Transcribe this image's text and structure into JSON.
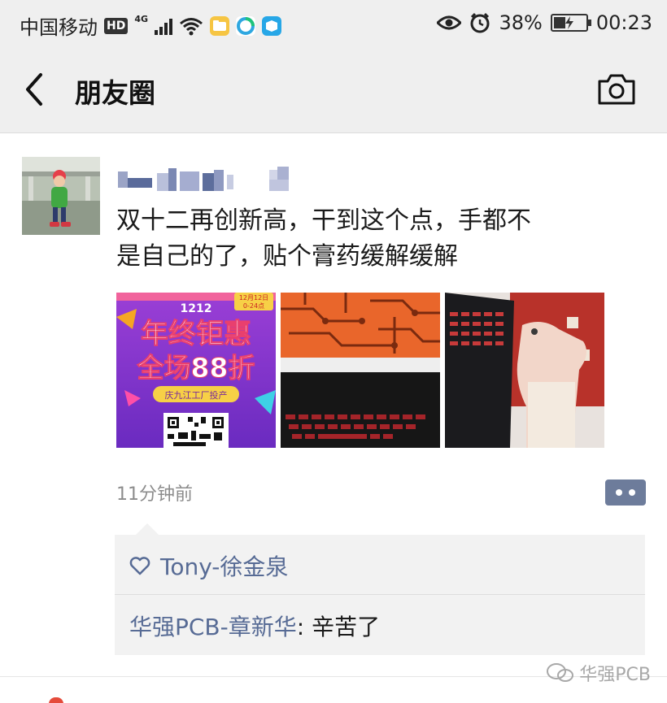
{
  "status_bar": {
    "carrier": "中国移动",
    "hd": "HD",
    "network": "4G",
    "battery": "38%",
    "battery_level": 0.38,
    "time": "00:23"
  },
  "header": {
    "title": "朋友圈"
  },
  "post": {
    "username": "",
    "text_line1": "双十二再创新高，干到这个点，手都不",
    "text_line2": "是自己的了，贴个膏药缓解缓解",
    "promo": {
      "date": "12月12日",
      "hours": "0-24点",
      "badge": "1212",
      "line1": "年终钜惠",
      "line2": "全场88折",
      "tag": "庆九江工厂投产"
    },
    "time_ago": "11分钟前"
  },
  "interactions": {
    "like_name": "Tony-徐金泉",
    "comment_author": "华强PCB-章新华",
    "comment_sep": ": ",
    "comment_text": "辛苦了"
  },
  "watermark": {
    "text": "华强PCB"
  }
}
